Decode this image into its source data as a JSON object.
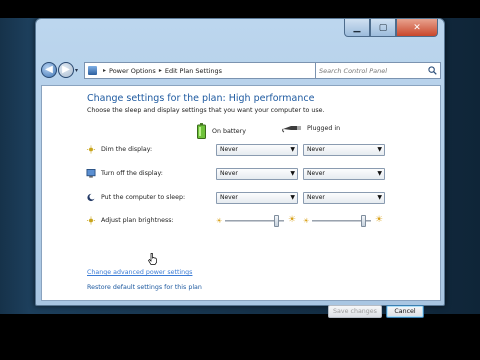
{
  "nav": {
    "breadcrumb": [
      "Power Options",
      "Edit Plan Settings"
    ],
    "search_placeholder": "Search Control Panel"
  },
  "page": {
    "title": "Change settings for the plan: High performance",
    "subtitle": "Choose the sleep and display settings that you want your computer to use."
  },
  "columns": {
    "battery": "On battery",
    "plugged": "Plugged in"
  },
  "settings": [
    {
      "label": "Dim the display:",
      "battery": "Never",
      "plugged": "Never",
      "icon": "dim-display-icon"
    },
    {
      "label": "Turn off the display:",
      "battery": "Never",
      "plugged": "Never",
      "icon": "monitor-icon"
    },
    {
      "label": "Put the computer to sleep:",
      "battery": "Never",
      "plugged": "Never",
      "icon": "sleep-moon-icon"
    }
  ],
  "brightness": {
    "label": "Adjust plan brightness:",
    "battery_level": 0.9,
    "plugged_level": 0.9
  },
  "links": {
    "advanced": "Change advanced power settings",
    "restore": "Restore default settings for this plan"
  },
  "buttons": {
    "save": "Save changes",
    "cancel": "Cancel"
  },
  "colors": {
    "accent_title": "#1e5aa0",
    "link": "#1e5aa0",
    "chrome": "#bcd6ee"
  }
}
